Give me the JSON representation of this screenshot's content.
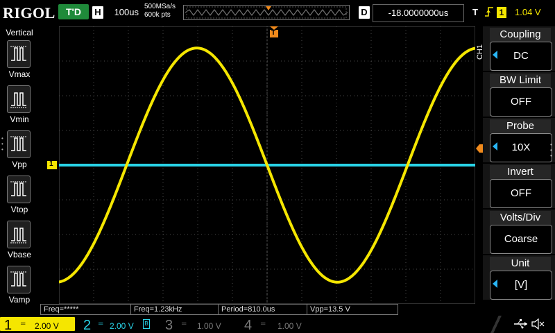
{
  "top": {
    "brand": "RIGOL",
    "run_status": "T'D",
    "horizontal_label": "H",
    "timebase": "100us",
    "sample_rate": "500MSa/s",
    "memory_depth": "600k pts",
    "delay_label": "D",
    "delay_offset": "-18.0000000us",
    "trigger_label": "T",
    "trigger_source": "1",
    "trigger_level": "1.04 V"
  },
  "left_menu": {
    "title": "Vertical",
    "items": [
      {
        "label": "Vmax",
        "icon": "vmax-icon"
      },
      {
        "label": "Vmin",
        "icon": "vmin-icon"
      },
      {
        "label": "Vpp",
        "icon": "vpp-icon"
      },
      {
        "label": "Vtop",
        "icon": "vtop-icon"
      },
      {
        "label": "Vbase",
        "icon": "vbase-icon"
      },
      {
        "label": "Vamp",
        "icon": "vamp-icon"
      }
    ]
  },
  "right_menu": {
    "channel_tag": "CH1",
    "items": [
      {
        "title": "Coupling",
        "value": "DC",
        "has_arrow": true
      },
      {
        "title": "BW Limit",
        "value": "OFF",
        "has_arrow": false
      },
      {
        "title": "Probe",
        "value": "10X",
        "has_arrow": true
      },
      {
        "title": "Invert",
        "value": "OFF",
        "has_arrow": false
      },
      {
        "title": "Volts/Div",
        "value": "Coarse",
        "has_arrow": false
      },
      {
        "title": "Unit",
        "value": "[V]",
        "has_arrow": true
      }
    ]
  },
  "markers": {
    "trigger_pos": "T",
    "ch1_ground": "1"
  },
  "measurements": [
    "Freq=*****",
    "Freq=1.23kHz",
    "Period=810.0us",
    "Vpp=13.5 V"
  ],
  "channels": [
    {
      "num": "1",
      "scale": "2.00 V",
      "color": "#f5e600",
      "active": true
    },
    {
      "num": "2",
      "scale": "2.00 V",
      "color": "#29d4e8",
      "active": true
    },
    {
      "num": "3",
      "scale": "1.00 V",
      "color": "#7a7a7a",
      "active": false
    },
    {
      "num": "4",
      "scale": "1.00 V",
      "color": "#7a7a7a",
      "active": false
    }
  ],
  "colors": {
    "ch1": "#f5e600",
    "ch2": "#29d4e8",
    "trigger_marker": "#f08a1c",
    "run_green": "#1f8a3a"
  },
  "chart_data": {
    "type": "line",
    "grid": {
      "h_divisions": 12,
      "v_divisions": 8
    },
    "series": [
      {
        "name": "CH1",
        "shape": "sine",
        "period_div": 8.1,
        "amplitude_div": 3.375,
        "phase_zero_cross_div": 6.0,
        "offset_div": 0
      },
      {
        "name": "CH2",
        "shape": "flat",
        "offset_div": 0
      }
    ]
  }
}
